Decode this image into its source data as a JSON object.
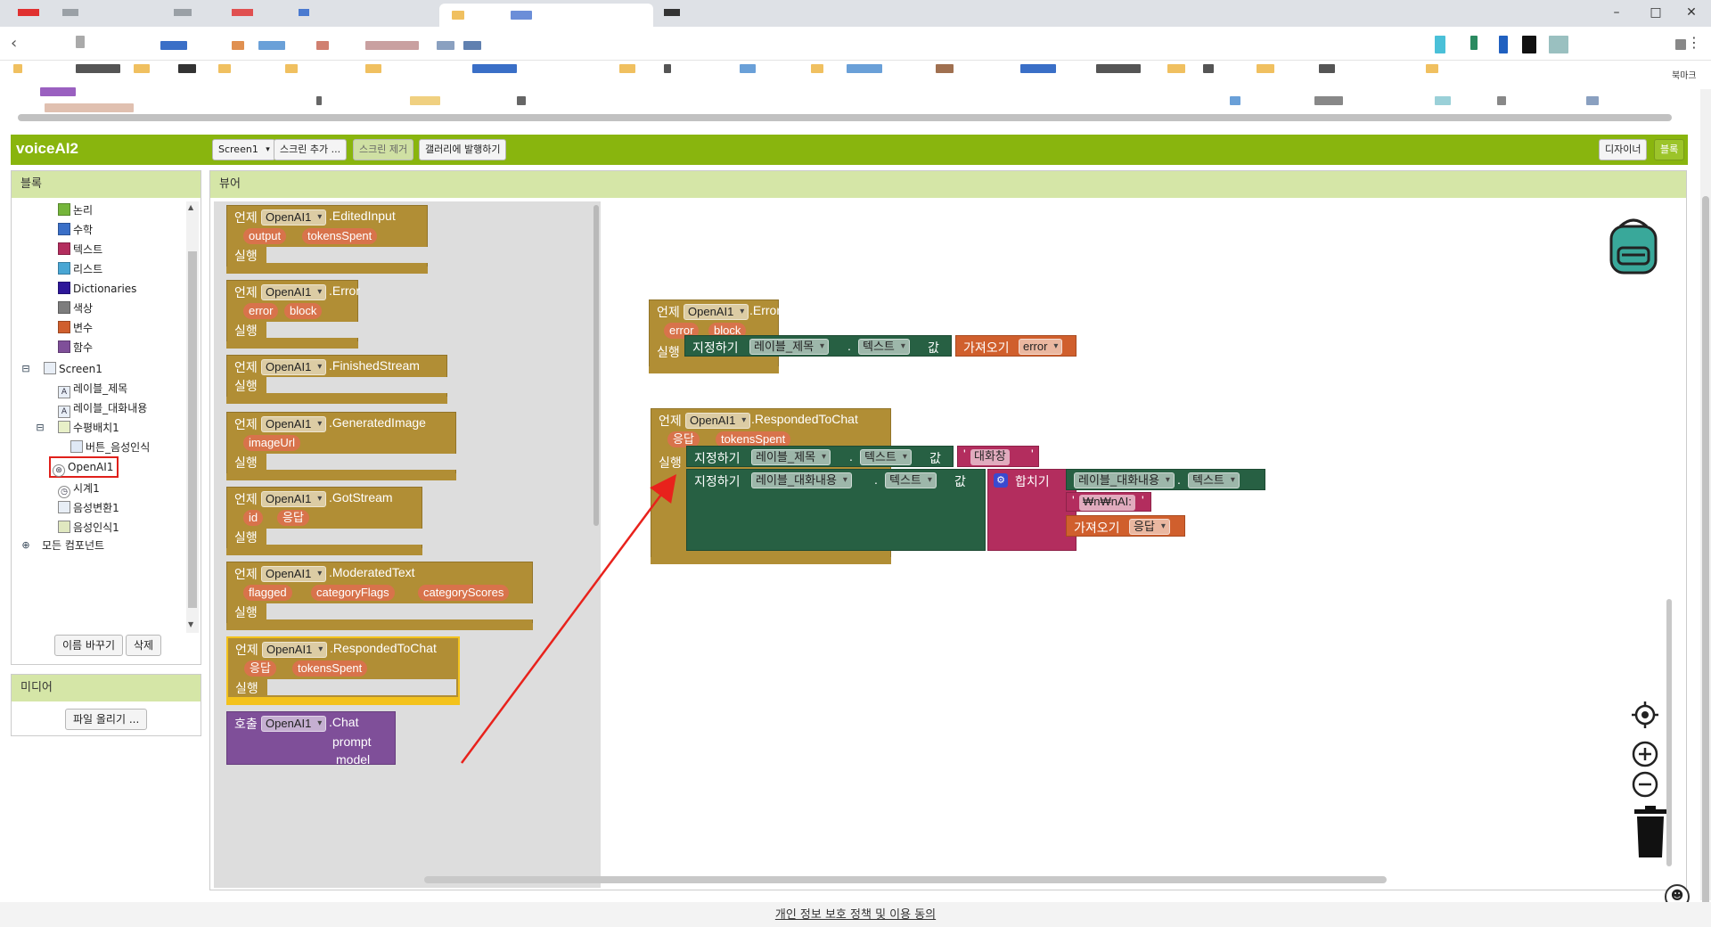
{
  "bookmark_hint": "북마크",
  "app": {
    "title": "voiceAI2",
    "screen_select": "Screen1",
    "add_screen": "스크린 추가 ...",
    "remove_screen": "스크린 제거",
    "publish_gallery": "갤러리에 발행하기",
    "designer": "디자이너",
    "blocks": "블록"
  },
  "blocks_panel": {
    "header": "블록",
    "builtins": [
      {
        "label": "논리",
        "color": "#75b53b"
      },
      {
        "label": "수학",
        "color": "#3a6fc7"
      },
      {
        "label": "텍스트",
        "color": "#b32d5e"
      },
      {
        "label": "리스트",
        "color": "#49a6d4"
      },
      {
        "label": "Dictionaries",
        "color": "#2d1799"
      },
      {
        "label": "색상",
        "color": "#7d7d7d"
      },
      {
        "label": "변수",
        "color": "#d05f2d"
      },
      {
        "label": "함수",
        "color": "#7f4f99"
      }
    ],
    "screen": "Screen1",
    "components": {
      "label_title": "레이블_제목",
      "label_chat": "레이블_대화내용",
      "hbox": "수평배치1",
      "button": "버튼_음성인식",
      "openai": "OpenAI1",
      "clock": "시계1",
      "tts": "음성변환1",
      "stt": "음성인식1"
    },
    "any_component": "모든 컴포넌트",
    "rename": "이름 바꾸기",
    "delete": "삭제"
  },
  "media_panel": {
    "header": "미디어",
    "upload": "파일 올리기 ..."
  },
  "viewer": {
    "header": "뷰어"
  },
  "keywords": {
    "when": "언제",
    "do": "실행",
    "call": "호출",
    "set": "지정하기",
    "to": "값",
    "get": "가져오기",
    "join": "합치기",
    "dot": "."
  },
  "flyout_blocks": [
    {
      "component": "OpenAI1",
      "event": ".EditedInput",
      "params": [
        "output",
        "tokensSpent"
      ]
    },
    {
      "component": "OpenAI1",
      "event": ".Error",
      "params": [
        "error",
        "block"
      ]
    },
    {
      "component": "OpenAI1",
      "event": ".FinishedStream",
      "params": []
    },
    {
      "component": "OpenAI1",
      "event": ".GeneratedImage",
      "params": [
        "imageUrl"
      ]
    },
    {
      "component": "OpenAI1",
      "event": ".GotStream",
      "params": [
        "id",
        "응답"
      ]
    },
    {
      "component": "OpenAI1",
      "event": ".ModeratedText",
      "params": [
        "flagged",
        "categoryFlags",
        "categoryScores"
      ]
    },
    {
      "component": "OpenAI1",
      "event": ".RespondedToChat",
      "params": [
        "응답",
        "tokensSpent"
      ]
    }
  ],
  "flyout_call": {
    "component": "OpenAI1",
    "method": ".Chat",
    "arg1": "prompt",
    "arg2": "model"
  },
  "workspace": {
    "error_block": {
      "component": "OpenAI1",
      "event": ".Error",
      "params": [
        "error",
        "block"
      ],
      "set_target": "레이블_제목",
      "set_prop": "텍스트",
      "get_var": "error"
    },
    "chat_block": {
      "component": "OpenAI1",
      "event": ".RespondedToChat",
      "params": [
        "응답",
        "tokensSpent"
      ],
      "set1_target": "레이블_제목",
      "set1_prop": "텍스트",
      "set1_value": "대화창",
      "set2_target": "레이블_대화내용",
      "set2_prop": "텍스트",
      "join_a_target": "레이블_대화내용",
      "join_a_prop": "텍스트",
      "join_b": "₩n₩nAI:",
      "join_c_var": "응답"
    }
  },
  "footer": {
    "privacy": "개인 정보 보호 정책 및 이용 동의"
  }
}
